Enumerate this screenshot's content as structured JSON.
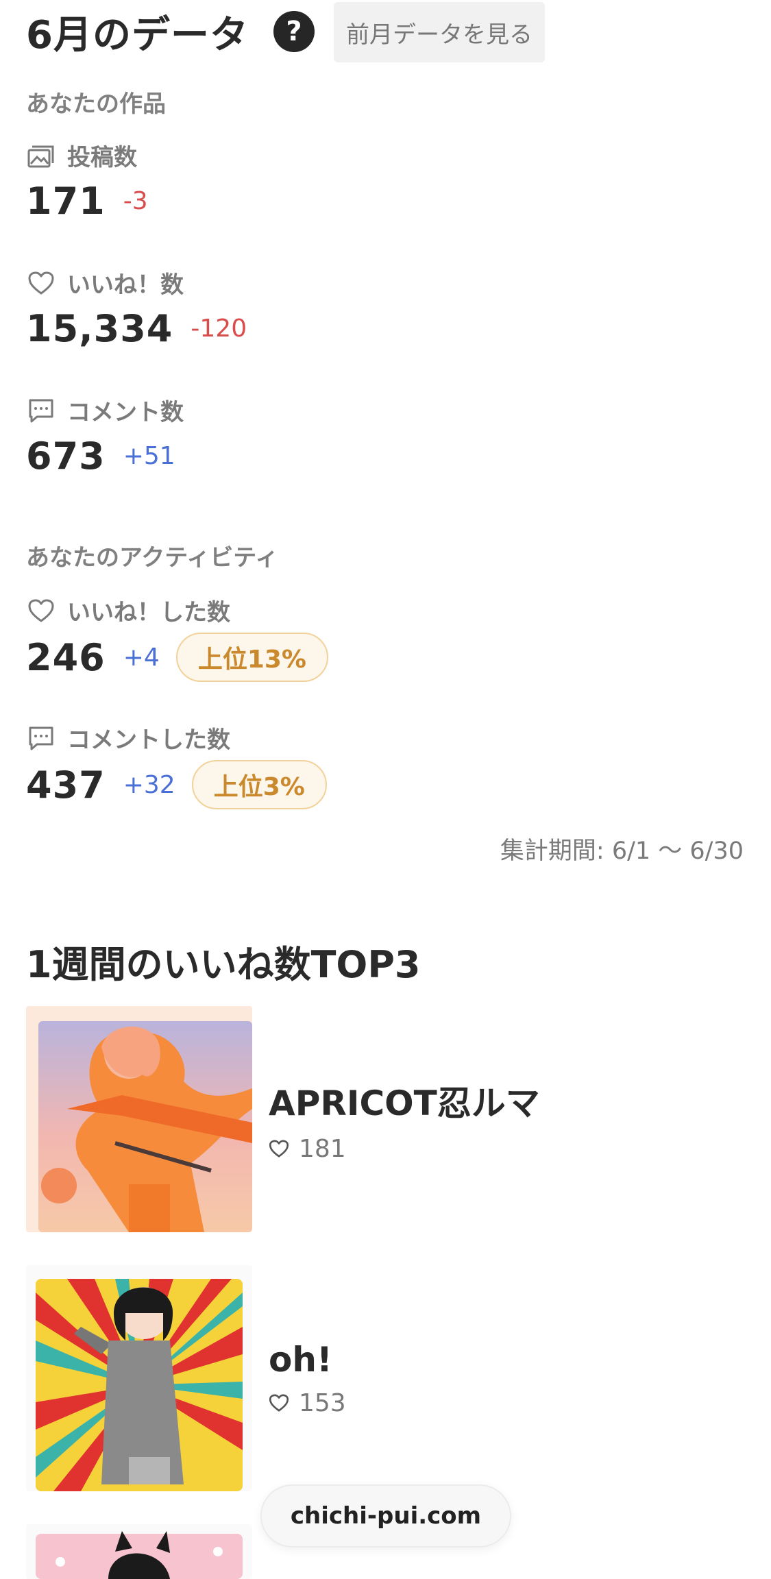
{
  "header": {
    "title": "6月のデータ",
    "help_icon": "question-icon",
    "help_label": "?",
    "prev_button_label": "前月データを見る"
  },
  "works_section": {
    "label": "あなたの作品",
    "metrics": [
      {
        "icon": "gallery-icon",
        "label": "投稿数",
        "value": "171",
        "delta": "-3"
      },
      {
        "icon": "heart-icon",
        "label": "いいね！数",
        "value": "15,334",
        "delta": "-120"
      },
      {
        "icon": "comment-icon",
        "label": "コメント数",
        "value": "673",
        "delta": "+51"
      }
    ]
  },
  "activity_section": {
    "label": "あなたのアクティビティ",
    "metrics": [
      {
        "icon": "heart-icon",
        "label": "いいね！した数",
        "value": "246",
        "delta": "+4",
        "rank": "上位13%"
      },
      {
        "icon": "comment-icon",
        "label": "コメントした数",
        "value": "437",
        "delta": "+32",
        "rank": "上位3%"
      }
    ]
  },
  "period": "集計期間: 6/1 〜 6/30",
  "top3": {
    "title": "1週間のいいね数TOP3",
    "items": [
      {
        "title": "APRICOT忍ルマ",
        "likes": "181"
      },
      {
        "title": "oh!",
        "likes": "153"
      }
    ]
  },
  "footer": {
    "site": "chichi-pui.com"
  },
  "colors": {
    "negative": "#d94c4c",
    "positive": "#4a6fd6",
    "badge_text": "#c9892c",
    "badge_border": "#f1d29a",
    "badge_bg": "#fdf6ea"
  }
}
